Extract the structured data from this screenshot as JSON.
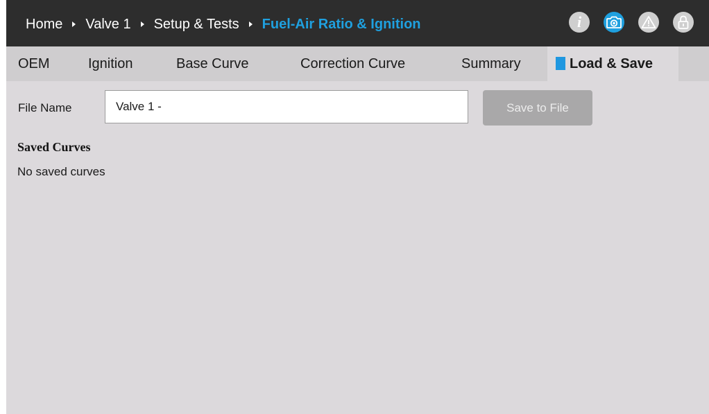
{
  "breadcrumb": {
    "items": [
      "Home",
      "Valve 1",
      "Setup & Tests"
    ],
    "current": "Fuel-Air Ratio & Ignition"
  },
  "header_icons": [
    {
      "name": "info-icon",
      "glyph": "i"
    },
    {
      "name": "camera-icon"
    },
    {
      "name": "warning-icon"
    },
    {
      "name": "lock-icon"
    }
  ],
  "tabs": [
    {
      "label": "OEM",
      "active": false
    },
    {
      "label": "Ignition",
      "active": false
    },
    {
      "label": "Base Curve",
      "active": false
    },
    {
      "label": "Correction Curve",
      "active": false
    },
    {
      "label": "Summary",
      "active": false
    },
    {
      "label": "Load & Save",
      "active": true
    }
  ],
  "form": {
    "file_name_label": "File Name",
    "file_name_value": "Valve 1 -",
    "save_button": "Save to File"
  },
  "saved": {
    "title": "Saved Curves",
    "empty_text": "No saved curves"
  },
  "colors": {
    "accent": "#1fa0df",
    "topbar": "#2d2d2d",
    "background": "#dcd9dc",
    "tabbar": "#cfcdcf",
    "disabled_button": "#a9a8a9"
  }
}
